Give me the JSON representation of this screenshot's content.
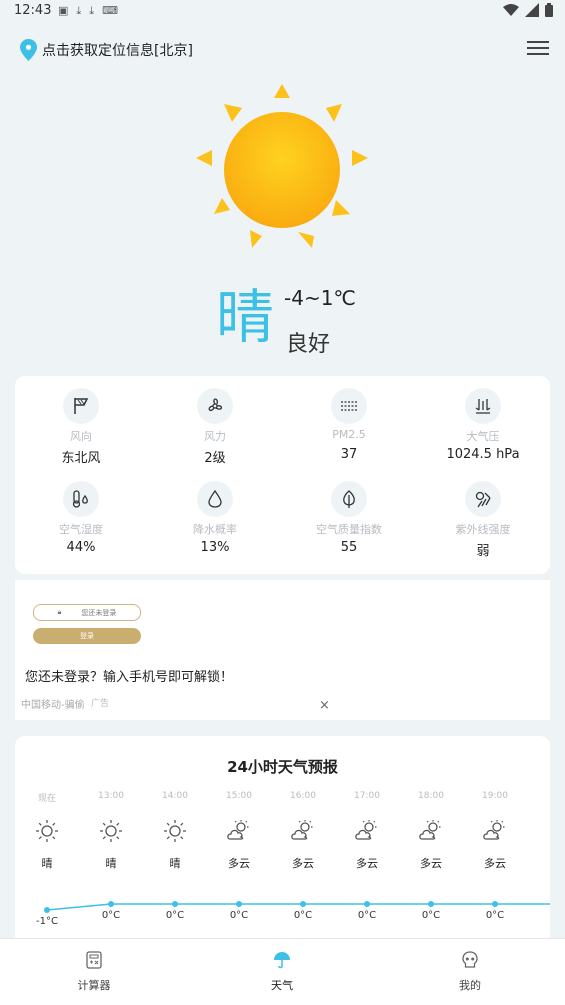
{
  "status": {
    "time": "12:43"
  },
  "location": {
    "label": "点击获取定位信息[北京]"
  },
  "current": {
    "condition": "晴",
    "temp_range": "-4~1℃",
    "quality": "良好"
  },
  "stats": [
    {
      "icon": "wind-direction-icon",
      "label": "风向",
      "value": "东北风"
    },
    {
      "icon": "fan-icon",
      "label": "风力",
      "value": "2级"
    },
    {
      "icon": "haze-icon",
      "label": "PM2.5",
      "value": "37"
    },
    {
      "icon": "pressure-icon",
      "label": "大气压",
      "value": "1024.5 hPa"
    },
    {
      "icon": "thermometer-drop-icon",
      "label": "空气湿度",
      "value": "44%"
    },
    {
      "icon": "water-drop-icon",
      "label": "降水概率",
      "value": "13%"
    },
    {
      "icon": "leaf-icon",
      "label": "空气质量指数",
      "value": "55"
    },
    {
      "icon": "uv-icon",
      "label": "紫外线强度",
      "value": "弱"
    }
  ],
  "ad": {
    "thumb_input": "您还未登录",
    "thumb_button": "登录",
    "text": "您还未登录？输入手机号即可解锁！",
    "source": "中国移动-骗偷",
    "tag": "广告",
    "close": "×"
  },
  "forecast": {
    "title": "24小时天气预报",
    "hours": [
      {
        "time": "现在",
        "desc": "晴",
        "icon": "sun-icon",
        "temp": "-1°C"
      },
      {
        "time": "13:00",
        "desc": "晴",
        "icon": "sun-icon",
        "temp": "0°C"
      },
      {
        "time": "14:00",
        "desc": "晴",
        "icon": "sun-icon",
        "temp": "0°C"
      },
      {
        "time": "15:00",
        "desc": "多云",
        "icon": "partly-cloudy-icon",
        "temp": "0°C"
      },
      {
        "time": "16:00",
        "desc": "多云",
        "icon": "partly-cloudy-icon",
        "temp": "0°C"
      },
      {
        "time": "17:00",
        "desc": "多云",
        "icon": "partly-cloudy-icon",
        "temp": "0°C"
      },
      {
        "time": "18:00",
        "desc": "多云",
        "icon": "partly-cloudy-icon",
        "temp": "0°C"
      },
      {
        "time": "19:00",
        "desc": "多云",
        "icon": "partly-cloudy-icon",
        "temp": "0°C"
      }
    ]
  },
  "nav": [
    {
      "icon": "calculator-icon",
      "label": "计算器"
    },
    {
      "icon": "umbrella-icon",
      "label": "天气"
    },
    {
      "icon": "skull-icon",
      "label": "我的"
    }
  ],
  "colors": {
    "accent": "#3cc0e6",
    "sun": "#fbb515",
    "background": "#eef3f6"
  }
}
